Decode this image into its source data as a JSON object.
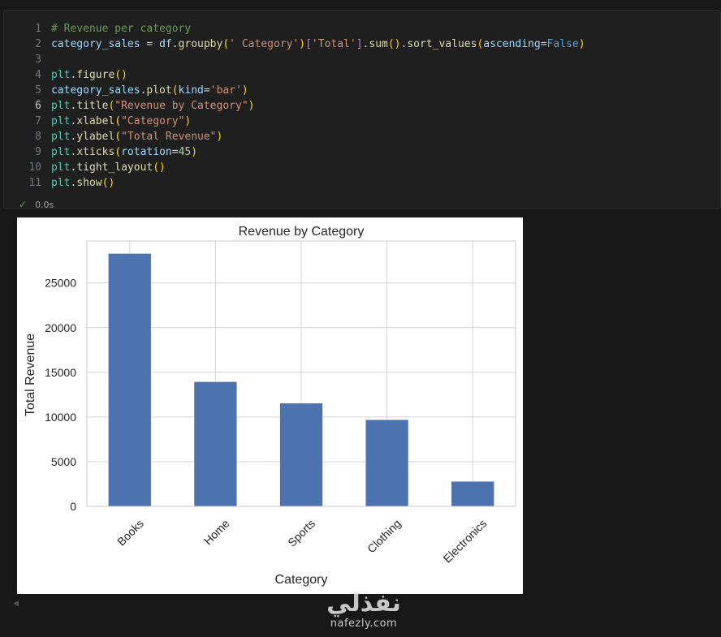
{
  "cell": {
    "lines": [
      {
        "no": "1",
        "tokens": [
          {
            "t": "# Revenue per category",
            "c": "#6a9955"
          }
        ]
      },
      {
        "no": "2",
        "tokens": [
          {
            "t": "category_sales",
            "c": "#9cdcfe"
          },
          {
            "t": " = ",
            "c": "#d4d4d4"
          },
          {
            "t": "df",
            "c": "#9cdcfe"
          },
          {
            "t": ".",
            "c": "#d4d4d4"
          },
          {
            "t": "groupby",
            "c": "#dcdcaa"
          },
          {
            "t": "(",
            "c": "#ffd700"
          },
          {
            "t": "' Category'",
            "c": "#ce9178"
          },
          {
            "t": ")",
            "c": "#ffd700"
          },
          {
            "t": "[",
            "c": "#da70d6"
          },
          {
            "t": "'Total'",
            "c": "#ce9178"
          },
          {
            "t": "]",
            "c": "#da70d6"
          },
          {
            "t": ".",
            "c": "#d4d4d4"
          },
          {
            "t": "sum",
            "c": "#dcdcaa"
          },
          {
            "t": "()",
            "c": "#ffd700"
          },
          {
            "t": ".",
            "c": "#d4d4d4"
          },
          {
            "t": "sort_values",
            "c": "#dcdcaa"
          },
          {
            "t": "(",
            "c": "#ffd700"
          },
          {
            "t": "ascending",
            "c": "#9cdcfe"
          },
          {
            "t": "=",
            "c": "#d4d4d4"
          },
          {
            "t": "False",
            "c": "#569cd6"
          },
          {
            "t": ")",
            "c": "#ffd700"
          }
        ]
      },
      {
        "no": "3",
        "tokens": []
      },
      {
        "no": "4",
        "tokens": [
          {
            "t": "plt",
            "c": "#4ec9b0"
          },
          {
            "t": ".",
            "c": "#d4d4d4"
          },
          {
            "t": "figure",
            "c": "#dcdcaa"
          },
          {
            "t": "()",
            "c": "#ffd700"
          }
        ]
      },
      {
        "no": "5",
        "tokens": [
          {
            "t": "category_sales",
            "c": "#9cdcfe"
          },
          {
            "t": ".",
            "c": "#d4d4d4"
          },
          {
            "t": "plot",
            "c": "#dcdcaa"
          },
          {
            "t": "(",
            "c": "#ffd700"
          },
          {
            "t": "kind",
            "c": "#9cdcfe"
          },
          {
            "t": "=",
            "c": "#d4d4d4"
          },
          {
            "t": "'bar'",
            "c": "#ce9178"
          },
          {
            "t": ")",
            "c": "#ffd700"
          }
        ]
      },
      {
        "no": "6",
        "tokens": [
          {
            "t": "plt",
            "c": "#4ec9b0"
          },
          {
            "t": ".",
            "c": "#d4d4d4"
          },
          {
            "t": "title",
            "c": "#dcdcaa"
          },
          {
            "t": "(",
            "c": "#ffd700"
          },
          {
            "t": "\"Revenue by Category\"",
            "c": "#ce9178"
          },
          {
            "t": ")",
            "c": "#ffd700"
          }
        ]
      },
      {
        "no": "7",
        "tokens": [
          {
            "t": "plt",
            "c": "#4ec9b0"
          },
          {
            "t": ".",
            "c": "#d4d4d4"
          },
          {
            "t": "xlabel",
            "c": "#dcdcaa"
          },
          {
            "t": "(",
            "c": "#ffd700"
          },
          {
            "t": "\"Category\"",
            "c": "#ce9178"
          },
          {
            "t": ")",
            "c": "#ffd700"
          }
        ]
      },
      {
        "no": "8",
        "tokens": [
          {
            "t": "plt",
            "c": "#4ec9b0"
          },
          {
            "t": ".",
            "c": "#d4d4d4"
          },
          {
            "t": "ylabel",
            "c": "#dcdcaa"
          },
          {
            "t": "(",
            "c": "#ffd700"
          },
          {
            "t": "\"Total Revenue\"",
            "c": "#ce9178"
          },
          {
            "t": ")",
            "c": "#ffd700"
          }
        ]
      },
      {
        "no": "9",
        "tokens": [
          {
            "t": "plt",
            "c": "#4ec9b0"
          },
          {
            "t": ".",
            "c": "#d4d4d4"
          },
          {
            "t": "xticks",
            "c": "#dcdcaa"
          },
          {
            "t": "(",
            "c": "#ffd700"
          },
          {
            "t": "rotation",
            "c": "#9cdcfe"
          },
          {
            "t": "=",
            "c": "#d4d4d4"
          },
          {
            "t": "45",
            "c": "#b5cea8"
          },
          {
            "t": ")",
            "c": "#ffd700"
          }
        ]
      },
      {
        "no": "10",
        "tokens": [
          {
            "t": "plt",
            "c": "#4ec9b0"
          },
          {
            "t": ".",
            "c": "#d4d4d4"
          },
          {
            "t": "tight_layout",
            "c": "#dcdcaa"
          },
          {
            "t": "()",
            "c": "#ffd700"
          }
        ]
      },
      {
        "no": "11",
        "tokens": [
          {
            "t": "plt",
            "c": "#4ec9b0"
          },
          {
            "t": ".",
            "c": "#d4d4d4"
          },
          {
            "t": "show",
            "c": "#dcdcaa"
          },
          {
            "t": "()",
            "c": "#ffd700"
          }
        ]
      }
    ],
    "active_line": "6",
    "exec_time": "0.0s"
  },
  "chart_data": {
    "type": "bar",
    "title": "Revenue by Category",
    "xlabel": "Category",
    "ylabel": "Total Revenue",
    "categories": [
      "Books",
      "Home",
      "Sports",
      "Clothing",
      "Electronics"
    ],
    "values": [
      28300,
      13950,
      11550,
      9700,
      2800
    ],
    "ylim": [
      0,
      29700
    ],
    "yticks": [
      0,
      5000,
      10000,
      15000,
      20000,
      25000
    ],
    "xtick_rotation": 45,
    "grid": true,
    "bar_color": "#4c72b0",
    "grid_color": "#d4d4d4"
  },
  "watermark": {
    "logo": "نفذلي",
    "url": "nafezly.com"
  }
}
